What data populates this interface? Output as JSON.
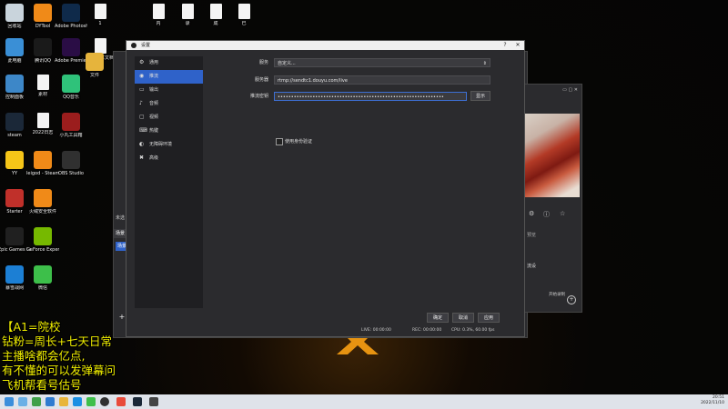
{
  "desktop": {
    "icons": [
      {
        "label": "回收站",
        "color": "#c9d4dc"
      },
      {
        "label": "DYTool",
        "color": "#f08a18"
      },
      {
        "label": "Adobe Photosh...",
        "color": "#0f2a4a"
      },
      {
        "label": "1",
        "color": "#f4f4f4"
      },
      {
        "label": "此电脑",
        "color": "#3a8fd6"
      },
      {
        "label": "腾讯QQ",
        "color": "#1a1a1a"
      },
      {
        "label": "Adobe Premie...",
        "color": "#2a0d45"
      },
      {
        "label": "新建文本文档",
        "color": "#f4f4f4"
      },
      {
        "label": "文件",
        "color": "#e6b43c"
      },
      {
        "label": "控制面板",
        "color": "#3d87c8"
      },
      {
        "label": "素材",
        "color": "#f4f4f4"
      },
      {
        "label": "QQ音乐",
        "color": "#2fc27a"
      },
      {
        "label": "steam",
        "color": "#1b2838"
      },
      {
        "label": "2022日志",
        "color": "#f4f4f4"
      },
      {
        "label": "小丸工具箱",
        "color": "#9b1d1d"
      },
      {
        "label": "YY",
        "color": "#f5c518"
      },
      {
        "label": "leigod - Steam版加速方式",
        "color": "#f08a18"
      },
      {
        "label": "OBS Studio",
        "color": "#303030"
      },
      {
        "label": "Starter",
        "color": "#c0302a"
      },
      {
        "label": "火绒安全软件",
        "color": "#f08a18"
      },
      {
        "label": "Epic Games Launcher",
        "color": "#202020"
      },
      {
        "label": "GeForce Experience",
        "color": "#76b900"
      },
      {
        "label": "暴雪战网",
        "color": "#1c7fd4"
      },
      {
        "label": "微信",
        "color": "#3dbf4a"
      }
    ],
    "top_files": [
      "内",
      "录",
      "成",
      "已"
    ],
    "overlay_lines": [
      "【A1=院校",
      "钻粉=周长+七天日常",
      "主播啥都会亿点,",
      "有不懂的可以发弹幕问",
      "飞机帮看号估号"
    ]
  },
  "taskbar": {
    "time": "20:51",
    "date": "2022/11/10"
  },
  "obs": {
    "scene_header": "未选",
    "scenes_label": "场景",
    "scene_item": "场景",
    "add_button": "+",
    "preview_text": "预览",
    "mixer_text": "流设",
    "start_text": "开始录制",
    "side_labels": [
      "间",
      "试"
    ]
  },
  "dialog": {
    "title": "设置",
    "nav": [
      {
        "label": "通用",
        "icon": "⚙"
      },
      {
        "label": "推流",
        "icon": "◉"
      },
      {
        "label": "输出",
        "icon": "▭"
      },
      {
        "label": "音频",
        "icon": "♪"
      },
      {
        "label": "视频",
        "icon": "▢"
      },
      {
        "label": "热键",
        "icon": "⌨"
      },
      {
        "label": "无障碍环境",
        "icon": "◐"
      },
      {
        "label": "高级",
        "icon": "✖"
      }
    ],
    "active_index": 1,
    "service_label": "服务",
    "service_value": "自定义...",
    "server_label": "服务器",
    "server_value": "rtmp://sendtc1.douyu.com/live",
    "key_label": "推流密钥",
    "key_value": "••••••••••••••••••••••••••••••••••••••••••••••••••••••••••••••",
    "show_button": "显示",
    "auth_label": "使用身份验证",
    "ok_button": "确定",
    "cancel_button": "取消",
    "apply_button": "应用",
    "status_live": "LIVE: 00:00:00",
    "status_rec": "REC: 00:00:00",
    "status_cpu": "CPU: 0.3%, 60.00 fps"
  }
}
